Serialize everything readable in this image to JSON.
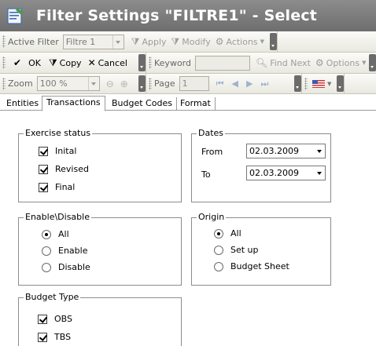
{
  "window": {
    "title": "Filter Settings \"FILTRE1\" - Select"
  },
  "toolbar1": {
    "active_filter_label": "Active Filter",
    "filter_value": "Filtre 1",
    "apply": "Apply",
    "modify": "Modify",
    "actions": "Actions"
  },
  "toolbar2": {
    "ok": "OK",
    "copy": "Copy",
    "cancel": "Cancel",
    "keyword_label": "Keyword",
    "keyword_value": "",
    "find_next": "Find Next",
    "options": "Options"
  },
  "toolbar3": {
    "zoom_label": "Zoom",
    "zoom_value": "100 %",
    "page_label": "Page",
    "page_value": "1"
  },
  "tabs": [
    {
      "label": "Entities",
      "active": false
    },
    {
      "label": "Transactions",
      "active": true
    },
    {
      "label": "Budget Codes",
      "active": false
    },
    {
      "label": "Format",
      "active": false
    }
  ],
  "exercise_status": {
    "title": "Exercise status",
    "items": [
      {
        "label": "Inital",
        "checked": true
      },
      {
        "label": "Revised",
        "checked": true
      },
      {
        "label": "Final",
        "checked": true
      }
    ]
  },
  "dates": {
    "title": "Dates",
    "from_label": "From",
    "from_value": "02.03.2009",
    "to_label": "To",
    "to_value": "02.03.2009"
  },
  "enable_disable": {
    "title": "Enable\\Disable",
    "options": [
      {
        "label": "All",
        "selected": true
      },
      {
        "label": "Enable",
        "selected": false
      },
      {
        "label": "Disable",
        "selected": false
      }
    ]
  },
  "origin": {
    "title": "Origin",
    "options": [
      {
        "label": "All",
        "selected": true
      },
      {
        "label": "Set up",
        "selected": false
      },
      {
        "label": "Budget Sheet",
        "selected": false
      }
    ]
  },
  "budget_type": {
    "title": "Budget Type",
    "items": [
      {
        "label": "OBS",
        "checked": true
      },
      {
        "label": "TBS",
        "checked": true
      }
    ]
  },
  "colors": {
    "titlebar": "#7d7d7d",
    "toolbar": "#eeede5",
    "disabled_text": "#9c9c9c"
  }
}
